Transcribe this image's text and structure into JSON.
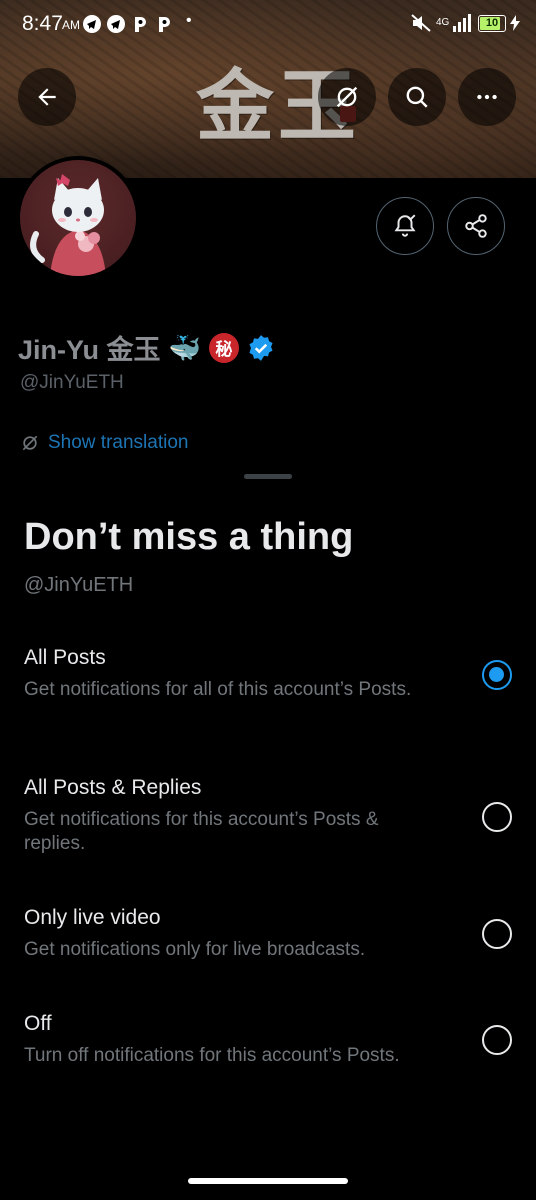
{
  "status_bar": {
    "time": "8:47",
    "ampm": "AM",
    "app_icons": [
      "telegram-icon",
      "telegram-icon",
      "p-icon",
      "p-icon"
    ],
    "dot": "•",
    "network": "4G",
    "battery": "10"
  },
  "banner": {
    "title": "金玉"
  },
  "profile": {
    "name": "Jin-Yu 金玉",
    "emoji": "🐳",
    "secret_badge": "秘",
    "handle": "@JinYuETH",
    "show_translation": "Show translation"
  },
  "sheet": {
    "title": "Don’t miss a thing",
    "handle": "@JinYuETH",
    "options": [
      {
        "title": "All Posts",
        "desc": "Get notifications for all of this account’s Posts.",
        "selected": true
      },
      {
        "title": "All Posts & Replies",
        "desc": "Get notifications for this account’s Posts & replies.",
        "selected": false
      },
      {
        "title": "Only live video",
        "desc": "Get notifications only for live broadcasts.",
        "selected": false
      },
      {
        "title": "Off",
        "desc": "Turn off notifications for this account’s Posts.",
        "selected": false
      }
    ]
  },
  "colors": {
    "accent": "#1d9bf0",
    "link": "#1d75b3",
    "muted": "#71767b",
    "verified": "#1d9bf0"
  }
}
